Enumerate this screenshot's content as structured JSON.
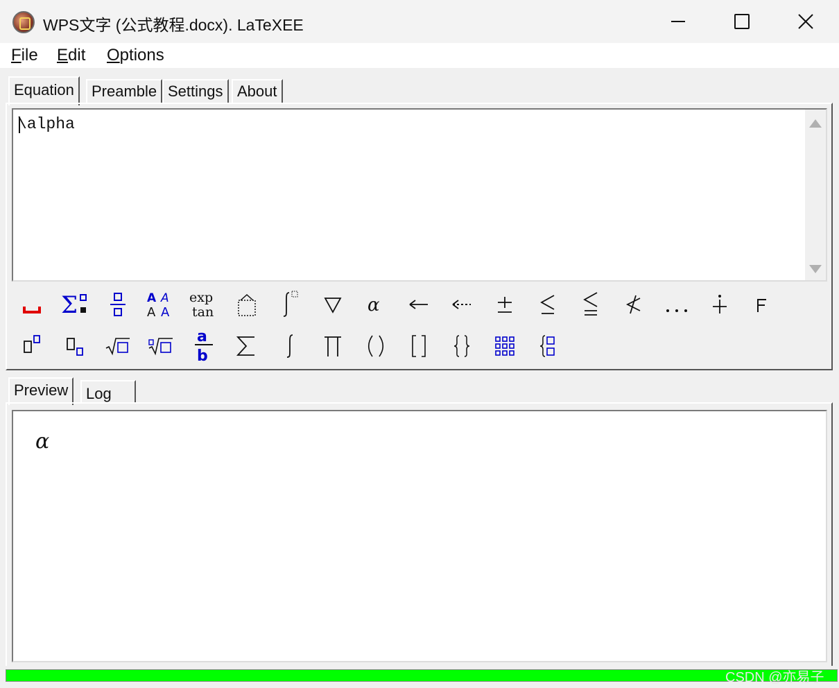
{
  "window": {
    "title": "WPS文字 (公式教程.docx). LaTeXEE",
    "app_icon": "latexee-app-icon"
  },
  "menu": [
    {
      "mnemonic": "F",
      "rest": "ile"
    },
    {
      "mnemonic": "E",
      "rest": "dit"
    },
    {
      "mnemonic": "O",
      "rest": "ptions"
    }
  ],
  "upper_tabs": [
    "Equation",
    "Preamble",
    "Settings",
    "About"
  ],
  "upper_tabs_active": "Equation",
  "editor": {
    "text": "\\alpha"
  },
  "toolbar_row1": [
    {
      "name": "space-icon",
      "label": "␣"
    },
    {
      "name": "sum-matrix-icon",
      "label": "Σ"
    },
    {
      "name": "fraction-stack-icon",
      "label": "÷"
    },
    {
      "name": "font-styles-icon",
      "label": "AA"
    },
    {
      "name": "exp-tan-icon",
      "label": "exp tan"
    },
    {
      "name": "accent-box-icon",
      "label": "□"
    },
    {
      "name": "integral-limits-icon",
      "label": "∫"
    },
    {
      "name": "nabla-icon",
      "label": "▽"
    },
    {
      "name": "alpha-icon",
      "label": "α"
    },
    {
      "name": "left-arrow-icon",
      "label": "←"
    },
    {
      "name": "dotted-left-arrow-icon",
      "label": "⇠"
    },
    {
      "name": "plus-minus-icon",
      "label": "±"
    },
    {
      "name": "leq-icon",
      "label": "≤"
    },
    {
      "name": "leqq-icon",
      "label": "≦"
    },
    {
      "name": "not-less-icon",
      "label": "≮"
    },
    {
      "name": "ellipsis-icon",
      "label": "…"
    },
    {
      "name": "dot-plus-icon",
      "label": "∔"
    },
    {
      "name": "corner-icon",
      "label": "⌜"
    }
  ],
  "toolbar_row2": [
    {
      "name": "superscript-icon",
      "label": "x²"
    },
    {
      "name": "subscript-icon",
      "label": "x₂"
    },
    {
      "name": "sqrt-icon",
      "label": "√"
    },
    {
      "name": "nth-root-icon",
      "label": "ⁿ√"
    },
    {
      "name": "fraction-ab-icon",
      "label": "a/b"
    },
    {
      "name": "sigma-icon",
      "label": "∑"
    },
    {
      "name": "integral-icon",
      "label": "∫"
    },
    {
      "name": "product-icon",
      "label": "∏"
    },
    {
      "name": "parentheses-icon",
      "label": "()"
    },
    {
      "name": "brackets-icon",
      "label": "[]"
    },
    {
      "name": "braces-icon",
      "label": "{}"
    },
    {
      "name": "matrix-icon",
      "label": "▦"
    },
    {
      "name": "cases-icon",
      "label": "{"
    }
  ],
  "lower_tabs": [
    "Preview",
    "Log"
  ],
  "lower_tabs_active": "Preview",
  "preview": {
    "rendered": "α"
  },
  "progress": {
    "value_percent": 100,
    "color": "#00ff00"
  },
  "watermark": "CSDN @亦易子",
  "colors": {
    "icon_blue": "#0000cc",
    "icon_red": "#e00000"
  }
}
